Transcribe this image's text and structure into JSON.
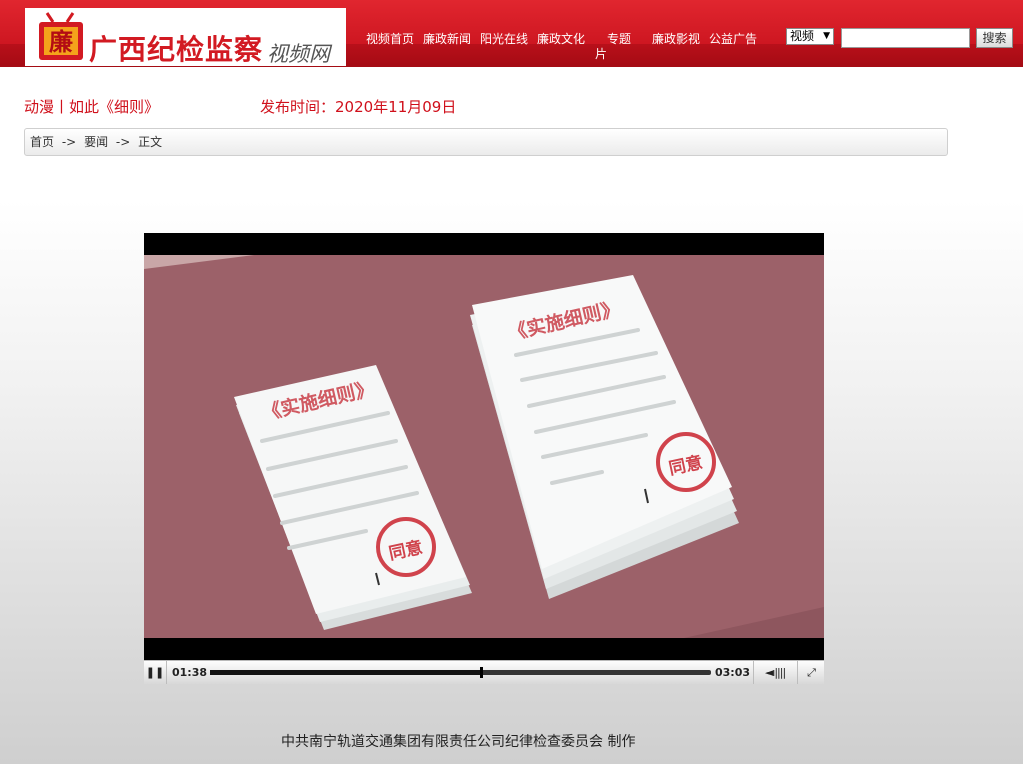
{
  "header": {
    "logo_glyph": "廉",
    "logo_text": "广西纪检监察",
    "logo_sub": "视频网",
    "nav": [
      "视频首页",
      "廉政新闻",
      "阳光在线",
      "廉政文化",
      "专题",
      "片",
      "廉政影视",
      "公益广告"
    ],
    "search_select": "视频",
    "search_placeholder": "",
    "search_button": "搜索",
    "brand_color": "#d21a22"
  },
  "article": {
    "title": "动漫丨如此《细则》",
    "publish_time": "发布时间：2020年11月09日"
  },
  "breadcrumb": [
    "首页",
    "->",
    "要闻",
    "->",
    "正文"
  ],
  "video": {
    "doc_title": "《实施细则》",
    "stamp_text": "同意",
    "current_time": "01:38",
    "duration": "03:03",
    "progress": 0.54
  },
  "footer": {
    "credit": "中共南宁轨道交通集团有限责任公司纪律检查委员会  制作"
  }
}
